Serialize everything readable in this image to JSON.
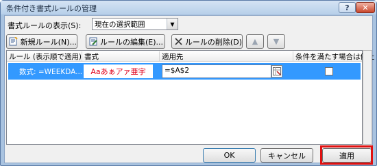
{
  "window": {
    "title": "条件付き書式ルールの管理",
    "help_label": "?",
    "close_label": "✕"
  },
  "show": {
    "label": "書式ルールの表示(S):",
    "selected": "現在の選択範囲"
  },
  "toolbar": {
    "new_label": "新規ルール(N)...",
    "edit_label": "ルールの編集(E)...",
    "delete_label": "ルールの削除(D)",
    "up_label": "▲",
    "down_label": "▼"
  },
  "list": {
    "columns": [
      "ルール (表示順で適用)",
      "書式",
      "適用先",
      "条件を満たす場合は停止"
    ],
    "rows": [
      {
        "rule": "数式: =WEEKDA...",
        "format_preview": "Aaあぁアァ亜宇",
        "applies_to": "=$A$2",
        "stop_if_true": false
      }
    ]
  },
  "footer": {
    "ok_label": "OK",
    "cancel_label": "キャンセル",
    "apply_label": "適用"
  },
  "colors": {
    "selection": "#3399ff",
    "highlight": "#e01010",
    "format_text": "#e0001b"
  }
}
